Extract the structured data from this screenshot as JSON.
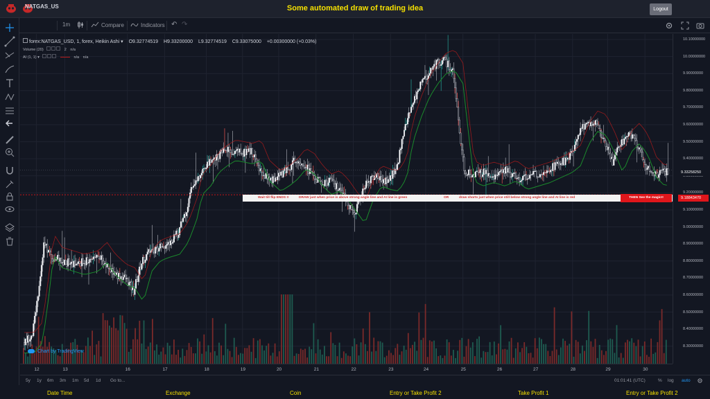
{
  "header": {
    "title": "Some automated draw of trading idea",
    "logout_label": "Logout"
  },
  "toolbar": {
    "symbol": "NATGAS_US",
    "interval": "1m",
    "compare_label": "Compare",
    "indicators_label": "Indicators"
  },
  "legend": {
    "main": "forex:NATGAS_USD, 1, forex, Heikin Ashi",
    "open": "O9.32774519",
    "high": "H9.33200000",
    "low": "L9.32774519",
    "close": "C9.33075000",
    "change": "+0.00300000 (+0.03%)",
    "volume_label": "Volume (20)",
    "volume_val1": "2",
    "volume_val2": "n/a",
    "ai_label": "AI (1, 1)",
    "ai_val1": "n/a",
    "ai_val2": "n/a"
  },
  "annotation": {
    "text1": "Wait till flip ENDS !!",
    "text2": "DRAW just when price is above strong angle line and AI line is green",
    "text3": "OR",
    "text4": "draw shorts just when price still below strong angle line and AI line is red",
    "magic": "THEN See the magic!!"
  },
  "price_tags": {
    "current": "9.33258250",
    "line": "9.18843470"
  },
  "chart_data": {
    "type": "candlestick",
    "chart_style": "Heikin Ashi",
    "y_ticks": [
      "10.10000000",
      "10.00000000",
      "9.90000000",
      "9.80000000",
      "9.70000000",
      "9.60000000",
      "9.50000000",
      "9.40000000",
      "9.30000000",
      "9.20000000",
      "9.10000000",
      "9.00000000",
      "8.90000000",
      "8.80000000",
      "8.70000000",
      "8.60000000",
      "8.50000000",
      "8.40000000",
      "8.30000000"
    ],
    "ylim": [
      8.25,
      10.1
    ],
    "x_ticks": [
      "12",
      "13",
      "16",
      "17",
      "18",
      "19",
      "20",
      "21",
      "22",
      "23",
      "24",
      "25",
      "26",
      "27",
      "28",
      "29",
      "30"
    ],
    "horizontal_line": 9.1884347,
    "current_price": 9.3325825,
    "colors": {
      "up": "#26a69a",
      "down": "#ef5350",
      "candle_up": "#ffffff",
      "candle_down": "#1e222d",
      "ai_green": "#1b8a2c",
      "ai_red": "#b71c1c"
    },
    "price_path": [
      {
        "x": 0.0,
        "y": 8.32
      },
      {
        "x": 0.3,
        "y": 8.38
      },
      {
        "x": 0.5,
        "y": 8.62
      },
      {
        "x": 0.7,
        "y": 8.9
      },
      {
        "x": 1.0,
        "y": 8.82
      },
      {
        "x": 1.4,
        "y": 8.8
      },
      {
        "x": 1.8,
        "y": 8.78
      },
      {
        "x": 2.3,
        "y": 8.8
      },
      {
        "x": 2.6,
        "y": 8.85
      },
      {
        "x": 2.9,
        "y": 8.78
      },
      {
        "x": 3.3,
        "y": 8.72
      },
      {
        "x": 3.6,
        "y": 8.7
      },
      {
        "x": 3.9,
        "y": 8.62
      },
      {
        "x": 4.2,
        "y": 8.8
      },
      {
        "x": 4.5,
        "y": 8.86
      },
      {
        "x": 4.8,
        "y": 8.88
      },
      {
        "x": 5.2,
        "y": 8.9
      },
      {
        "x": 5.5,
        "y": 8.97
      },
      {
        "x": 5.8,
        "y": 9.1
      },
      {
        "x": 6.0,
        "y": 9.25
      },
      {
        "x": 6.3,
        "y": 9.3
      },
      {
        "x": 6.6,
        "y": 9.38
      },
      {
        "x": 6.9,
        "y": 9.42
      },
      {
        "x": 7.2,
        "y": 9.45
      },
      {
        "x": 7.5,
        "y": 9.44
      },
      {
        "x": 7.8,
        "y": 9.43
      },
      {
        "x": 8.1,
        "y": 9.45
      },
      {
        "x": 8.4,
        "y": 9.33
      },
      {
        "x": 8.8,
        "y": 9.27
      },
      {
        "x": 9.1,
        "y": 9.3
      },
      {
        "x": 9.4,
        "y": 9.34
      },
      {
        "x": 9.7,
        "y": 9.4
      },
      {
        "x": 10.0,
        "y": 9.37
      },
      {
        "x": 10.3,
        "y": 9.3
      },
      {
        "x": 10.6,
        "y": 9.25
      },
      {
        "x": 10.9,
        "y": 9.27
      },
      {
        "x": 11.2,
        "y": 9.22
      },
      {
        "x": 11.5,
        "y": 9.15
      },
      {
        "x": 11.8,
        "y": 9.08
      },
      {
        "x": 12.1,
        "y": 9.22
      },
      {
        "x": 12.4,
        "y": 9.3
      },
      {
        "x": 12.7,
        "y": 9.28
      },
      {
        "x": 13.0,
        "y": 9.27
      },
      {
        "x": 13.3,
        "y": 9.35
      },
      {
        "x": 13.5,
        "y": 9.55
      },
      {
        "x": 13.8,
        "y": 9.7
      },
      {
        "x": 14.1,
        "y": 9.82
      },
      {
        "x": 14.4,
        "y": 9.9
      },
      {
        "x": 14.7,
        "y": 9.96
      },
      {
        "x": 15.0,
        "y": 9.98
      },
      {
        "x": 15.3,
        "y": 9.9
      },
      {
        "x": 15.5,
        "y": 9.6
      },
      {
        "x": 15.7,
        "y": 9.33
      },
      {
        "x": 16.0,
        "y": 9.3
      },
      {
        "x": 16.4,
        "y": 9.32
      },
      {
        "x": 16.8,
        "y": 9.3
      },
      {
        "x": 17.2,
        "y": 9.33
      },
      {
        "x": 17.6,
        "y": 9.28
      },
      {
        "x": 18.0,
        "y": 9.3
      },
      {
        "x": 18.4,
        "y": 9.32
      },
      {
        "x": 18.8,
        "y": 9.35
      },
      {
        "x": 19.2,
        "y": 9.38
      },
      {
        "x": 19.5,
        "y": 9.42
      },
      {
        "x": 19.8,
        "y": 9.55
      },
      {
        "x": 20.1,
        "y": 9.62
      },
      {
        "x": 20.4,
        "y": 9.6
      },
      {
        "x": 20.7,
        "y": 9.5
      },
      {
        "x": 21.0,
        "y": 9.38
      },
      {
        "x": 21.3,
        "y": 9.5
      },
      {
        "x": 21.6,
        "y": 9.55
      },
      {
        "x": 21.9,
        "y": 9.48
      },
      {
        "x": 22.2,
        "y": 9.35
      },
      {
        "x": 22.5,
        "y": 9.3
      },
      {
        "x": 22.8,
        "y": 9.32
      },
      {
        "x": 23.0,
        "y": 9.33
      }
    ]
  },
  "time_axis": {
    "ranges": [
      "5y",
      "1y",
      "6m",
      "3m",
      "1m",
      "5d",
      "1d"
    ],
    "goto_label": "Go to...",
    "clock": "01:01:41 (UTC)",
    "percent": "%",
    "log": "log",
    "auto": "auto"
  },
  "watermark": "Chart by TradingView",
  "footer": {
    "items": [
      "Date Time",
      "Exchange",
      "Coin",
      "Entry or Take Profit 2",
      "Take Profit 1",
      "Entry or Take Profit 2"
    ]
  }
}
